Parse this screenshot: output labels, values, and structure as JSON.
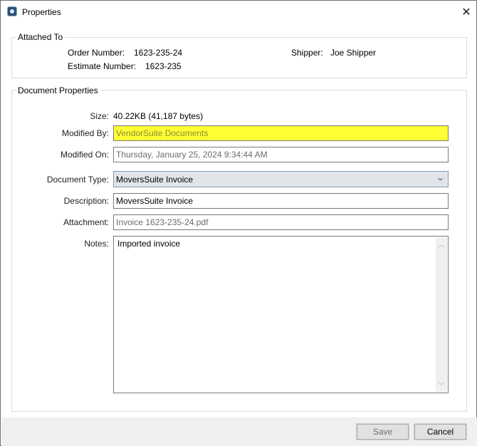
{
  "window": {
    "title": "Properties"
  },
  "attached_to": {
    "legend": "Attached To",
    "order_label": "Order Number:",
    "order_value": "1623-235-24",
    "estimate_label": "Estimate Number:",
    "estimate_value": "1623-235",
    "shipper_label": "Shipper:",
    "shipper_value": "Joe Shipper"
  },
  "doc": {
    "legend": "Document Properties",
    "size_label": "Size:",
    "size_value": "40.22KB (41,187 bytes)",
    "modified_by_label": "Modified By:",
    "modified_by_value": "VendorSuite Documents",
    "modified_on_label": "Modified On:",
    "modified_on_value": "Thursday, January 25, 2024 9:34:44 AM",
    "doc_type_label": "Document Type:",
    "doc_type_value": "MoversSuite Invoice",
    "description_label": "Description:",
    "description_value": "MoversSuite Invoice",
    "attachment_label": "Attachment:",
    "attachment_value": "Invoice 1623-235-24.pdf",
    "notes_label": "Notes:",
    "notes_value": "Imported invoice"
  },
  "buttons": {
    "save": "Save",
    "cancel": "Cancel"
  },
  "colors": {
    "highlight": "#ffff33",
    "highlight_text": "#8a8a3a",
    "readonly_text": "#6d6d6d",
    "combo_bg": "#e1e5ea"
  }
}
